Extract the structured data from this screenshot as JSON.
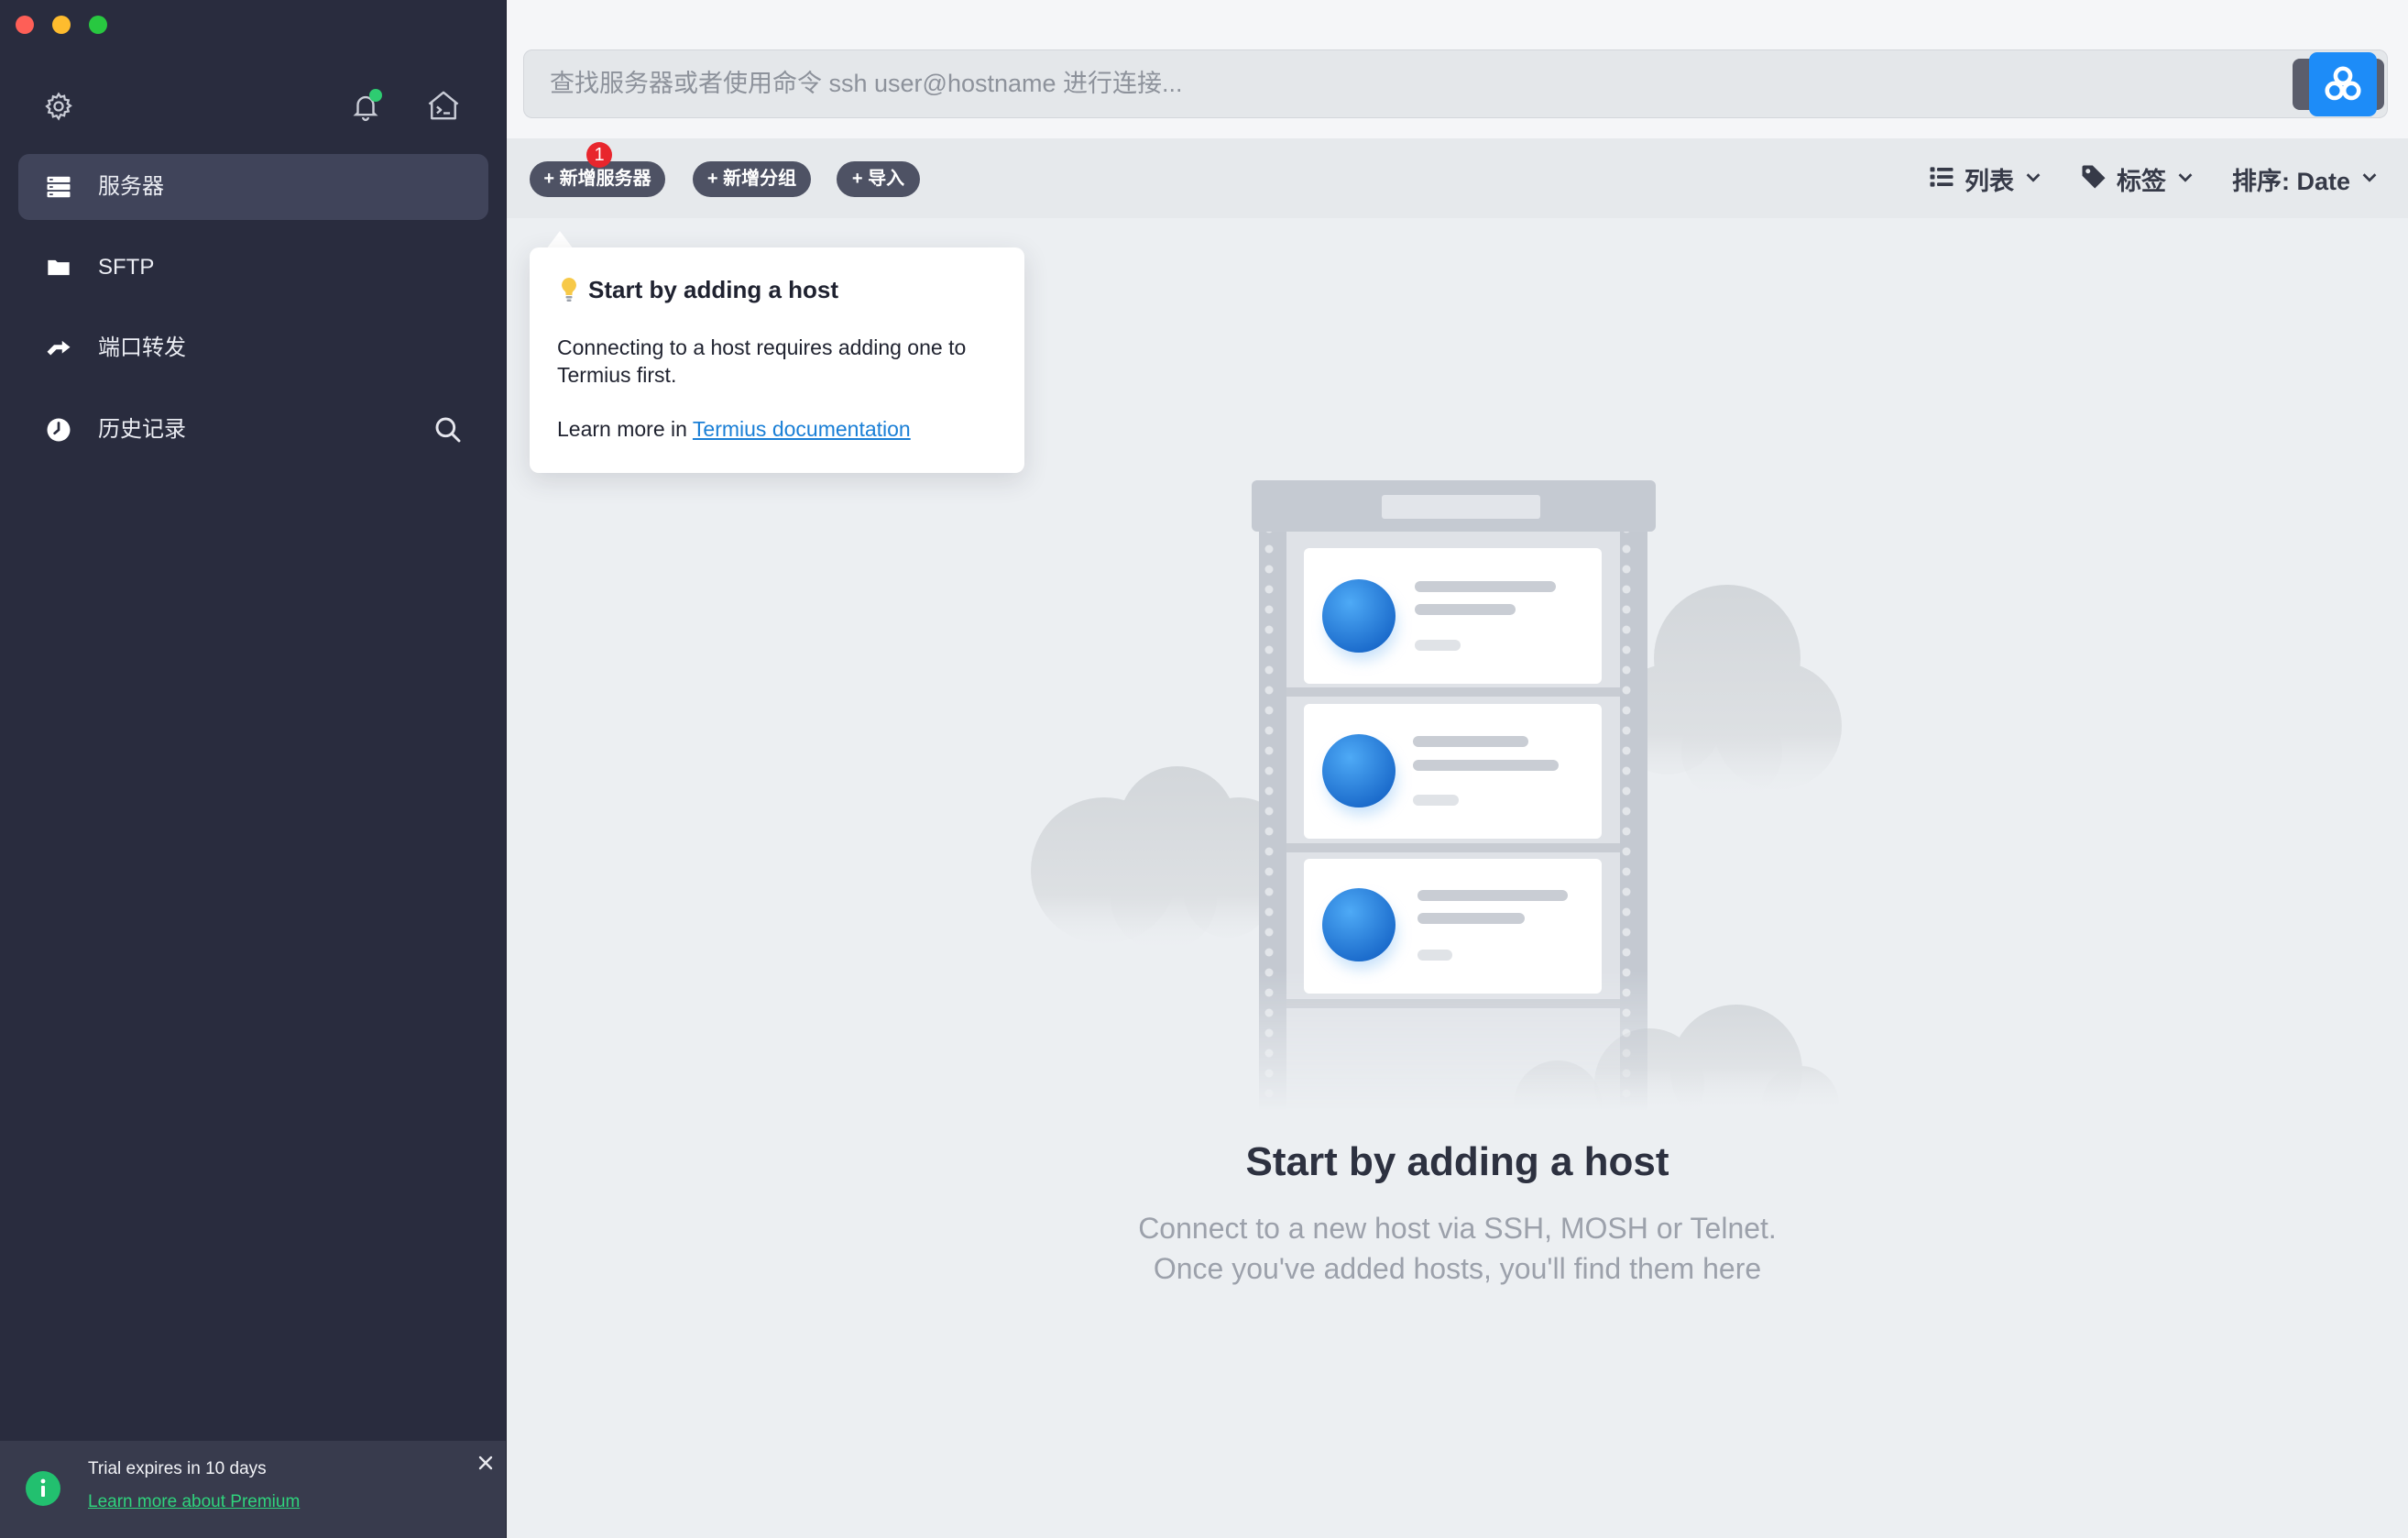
{
  "window": {
    "controls": [
      {
        "name": "close",
        "color": "#fe5f57"
      },
      {
        "name": "minimize",
        "color": "#febc2e"
      },
      {
        "name": "zoom",
        "color": "#28c840"
      }
    ]
  },
  "sidebar": {
    "header_icons": [
      "gear-icon",
      "bell-icon",
      "terminal-home-icon"
    ],
    "notification_dot_color": "#2ecc71",
    "items": [
      {
        "label": "服务器",
        "icon": "server-icon",
        "active": true
      },
      {
        "label": "SFTP",
        "icon": "folder-icon",
        "active": false
      },
      {
        "label": "端口转发",
        "icon": "port-forward-icon",
        "active": false
      },
      {
        "label": "历史记录",
        "icon": "history-icon",
        "active": false,
        "trailing_icon": "search-icon"
      }
    ],
    "trial_banner": {
      "icon": "info-icon",
      "message": "Trial expires in 10 days",
      "link": "Learn more about Premium",
      "close_icon": "close-icon"
    }
  },
  "search": {
    "placeholder": "查找服务器或者使用命令 ssh user@hostname 进行连接...",
    "value": "",
    "app_icon": "cloud-cluster-icon"
  },
  "toolbar": {
    "new_host_label": "+ 新增服务器",
    "new_host_badge": "1",
    "new_group_label": "+ 新增分组",
    "import_label": "+ 导入",
    "view_icon": "list-icon",
    "view_label": "列表",
    "tags_icon": "tag-icon",
    "tags_label": "标签",
    "sort_label": "排序: Date"
  },
  "popover": {
    "icon": "lightbulb-icon",
    "title": "Start by adding a host",
    "body_line1": "Connecting to a host requires adding one to",
    "body_line2": "Termius first.",
    "learn_prefix": "Learn more in",
    "learn_link": "Termius documentation"
  },
  "empty_state": {
    "illustration": "server-rack-illustration",
    "title": "Start by adding a host",
    "line1": "Connect to a new host via SSH, MOSH or Telnet.",
    "line2": "Once you've added hosts, you'll find them here"
  },
  "colors": {
    "sidebar_bg": "#292c3e",
    "sidebar_active": "#40445a",
    "accent_blue": "#1d8cf8",
    "link_blue": "#1a7fd6",
    "premium_green": "#2fd37c",
    "badge_red": "#e8262d"
  }
}
